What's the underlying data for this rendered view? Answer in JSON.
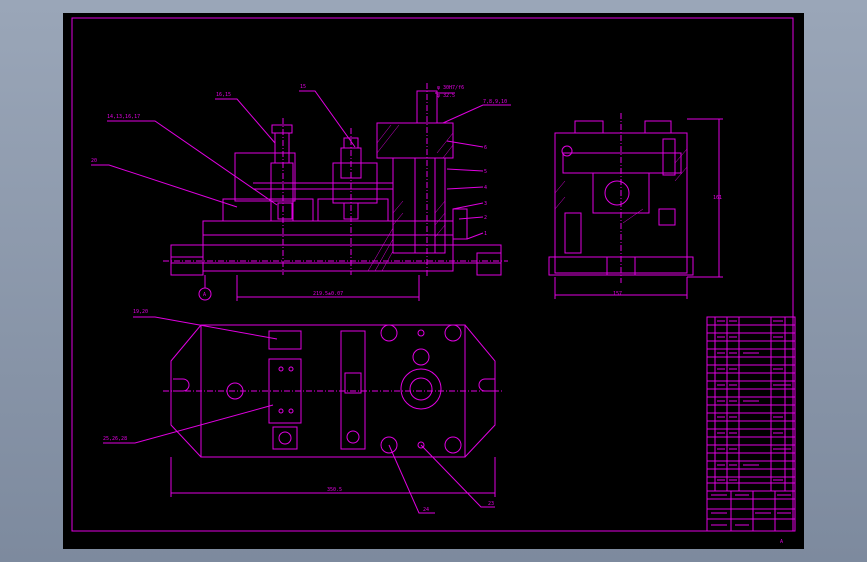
{
  "labels": {
    "front_view": {
      "leader_1": "16,15",
      "leader_2": "15",
      "leader_3": "14,13,16,17",
      "leader_4": "20",
      "leader_top": "φ 30H7/f6",
      "leader_top2": "φ 32.5",
      "leader_right": "7,8,9,10",
      "callouts_right": [
        "6",
        "5",
        "4",
        "3",
        "2",
        "1"
      ],
      "width_dim": "219.5±0.07",
      "datum": "A"
    },
    "side_view": {
      "height_dim": "161",
      "width_dim": "157"
    },
    "top_view": {
      "leader_top": "19,20",
      "leader_left": "25,26,28",
      "width_dim": "350.5",
      "leader_bottom_1": "24",
      "leader_bottom_2": "23"
    }
  },
  "title_block": {
    "sheet_no": "A"
  }
}
